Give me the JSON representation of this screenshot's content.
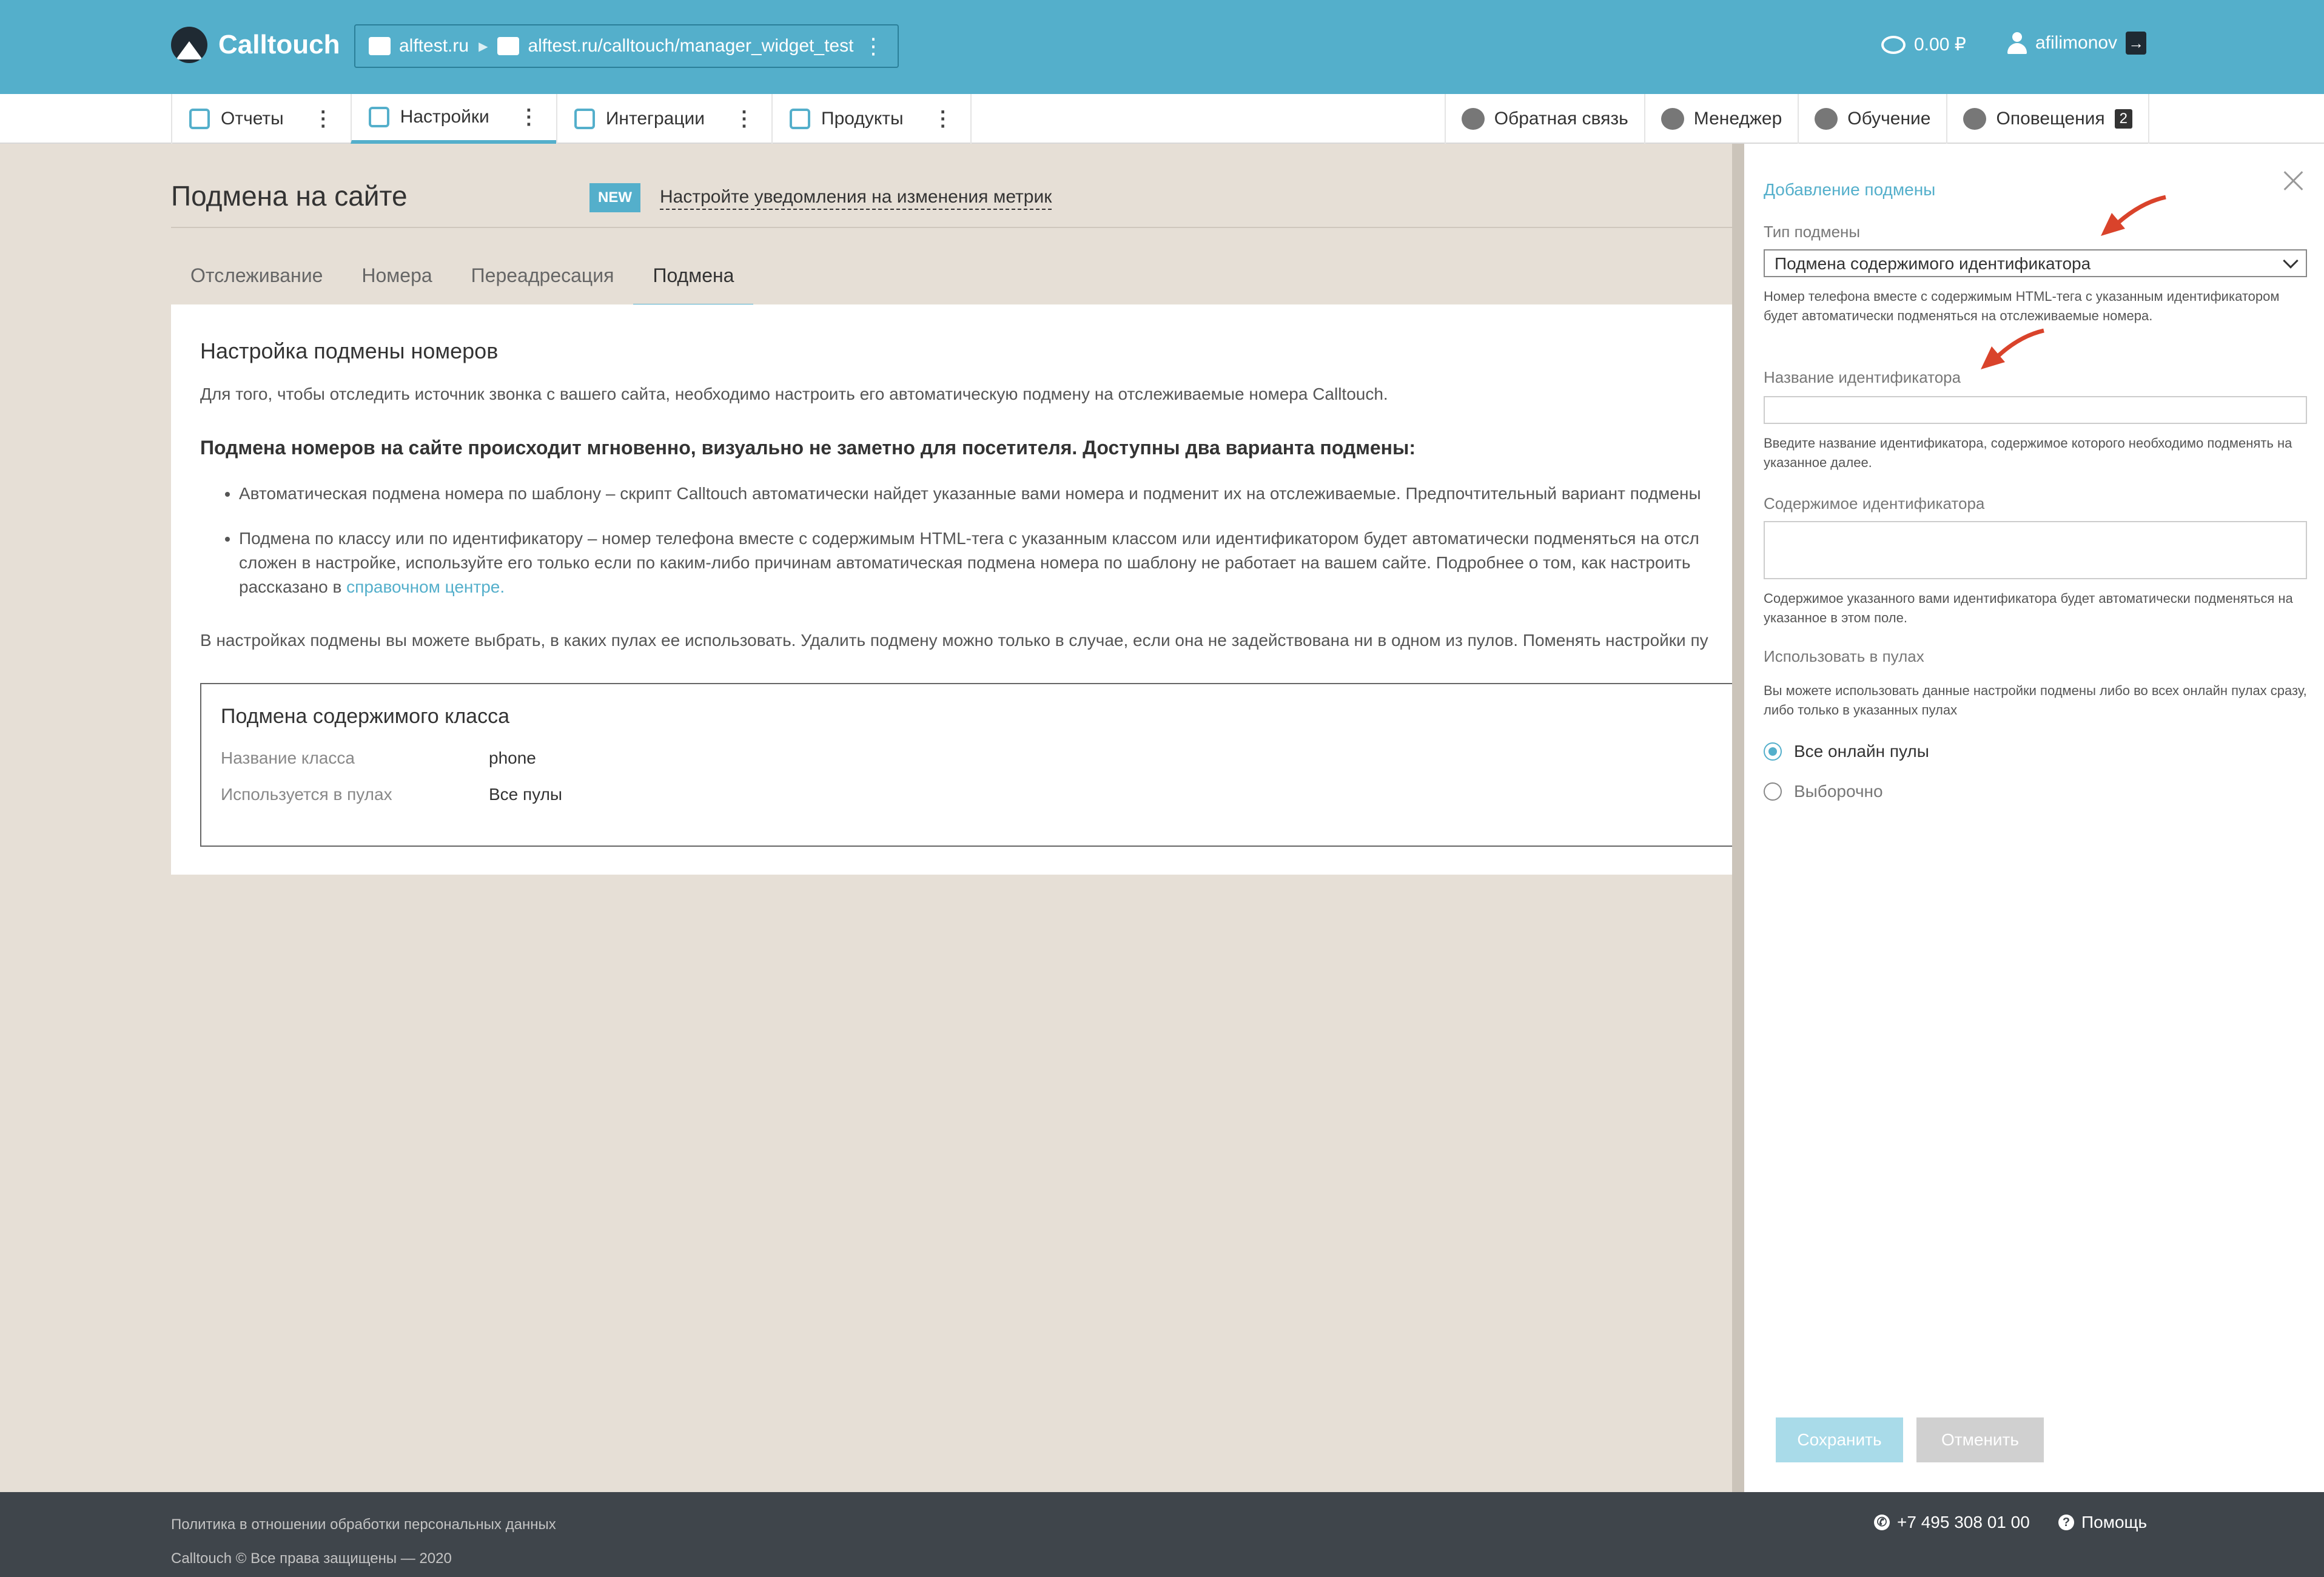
{
  "header": {
    "logo_text": "Calltouch",
    "site": "alftest.ru",
    "site_path": "alftest.ru/calltouch/manager_widget_test",
    "balance": "0.00 ₽",
    "username": "afilimonov"
  },
  "nav": {
    "left": [
      {
        "label": "Отчеты",
        "icon": "report-icon"
      },
      {
        "label": "Настройки",
        "icon": "settings-icon",
        "active": true
      },
      {
        "label": "Интеграции",
        "icon": "integrations-icon"
      },
      {
        "label": "Продукты",
        "icon": "products-icon"
      }
    ],
    "right": [
      {
        "label": "Обратная связь",
        "icon": "feedback-icon"
      },
      {
        "label": "Менеджер",
        "icon": "manager-icon"
      },
      {
        "label": "Обучение",
        "icon": "education-icon"
      },
      {
        "label": "Оповещения",
        "icon": "bell-icon",
        "badge": "2"
      }
    ]
  },
  "page": {
    "title": "Подмена на сайте",
    "new_badge": "NEW",
    "new_link": "Настройте уведомления на изменения метрик",
    "tabs": [
      "Отслеживание",
      "Номера",
      "Переадресация",
      "Подмена"
    ],
    "active_tab": "Подмена"
  },
  "content": {
    "heading": "Настройка подмены номеров",
    "intro": "Для того, чтобы отследить источник звонка с вашего сайта, необходимо настроить его автоматическую подмену на отслеживаемые номера Calltouch.",
    "bold_text": "Подмена номеров на сайте происходит мгновенно, визуально не заметно для посетителя. Доступны два варианта подмены:",
    "bullet1": "Автоматическая подмена номера по шаблону – скрипт Calltouch автоматически найдет указанные вами номера и подменит их на отслеживаемые. Предпочтительный вариант подмены",
    "bullet2_part1": "Подмена по классу или по идентификатору – номер телефона вместе с содержимым HTML-тега с указанным классом или идентификатором будет автоматически подменяться на отсл",
    "bullet2_part2": "сложен в настройке, используйте его только если по каким-либо причинам автоматическая подмена номера по шаблону не работает на вашем сайте. Подробнее о том, как настроить",
    "bullet2_part3": "рассказано в ",
    "bullet2_link": "справочном центре.",
    "pools_text": "В настройках подмены вы можете выбрать, в каких пулах ее использовать. Удалить подмену можно только в случае, если она не задействована ни в одном из пулов. Поменять настройки пу",
    "box": {
      "title": "Подмена содержимого класса",
      "rows": [
        {
          "key": "Название класса",
          "value": "phone"
        },
        {
          "key": "Используется в пулах",
          "value": "Все пулы"
        }
      ]
    }
  },
  "panel": {
    "title": "Добавление подмены",
    "type_label": "Тип подмены",
    "type_value": "Подмена содержимого идентификатора",
    "type_help": "Номер телефона вместе с содержимым HTML-тега с указанным идентификатором будет автоматически подменяться на отслеживаемые номера.",
    "id_label": "Название идентификатора",
    "id_value": "",
    "id_help": "Введите название идентификатора, содержимое которого необходимо подменять на указанное далее.",
    "content_label": "Содержимое идентификатора",
    "content_value": "",
    "content_help": "Содержимое указанного вами идентификатора будет автоматически подменяться на указанное в этом поле.",
    "pools_label": "Использовать в пулах",
    "pools_help": "Вы можете использовать данные настройки подмены либо во всех онлайн пулах сразу, либо только в указанных пулах",
    "radio_all": "Все онлайн пулы",
    "radio_selected": "Выборочно",
    "save": "Сохранить",
    "cancel": "Отменить",
    "arrow_color": "#d9432b"
  },
  "footer": {
    "privacy": "Политика в отношении обработки персональных данных",
    "copyright": "Calltouch © Все права защищены — 2020",
    "phone": "+7 495 308 01 00",
    "help": "Помощь"
  }
}
